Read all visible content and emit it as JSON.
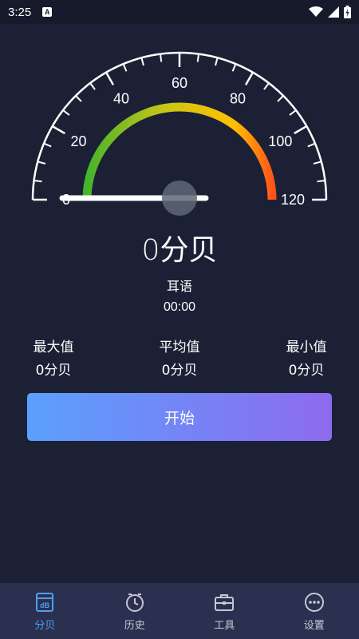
{
  "status_bar": {
    "time": "3:25",
    "badge": "A"
  },
  "gauge": {
    "min": 0,
    "max": 120,
    "tick_labels": [
      "0",
      "20",
      "40",
      "60",
      "80",
      "100",
      "120"
    ],
    "current_value": 0,
    "gradient_colors": [
      "#3db32c",
      "#c8c617",
      "#ffc000",
      "#ff4a1a"
    ],
    "needle_color": "#ffffff",
    "pivot_color": "#5f6977"
  },
  "reading": {
    "text": "0分贝"
  },
  "level_text": "耳语",
  "timer": "00:00",
  "stats": {
    "max": {
      "label": "最大值",
      "value": "0分贝"
    },
    "avg": {
      "label": "平均值",
      "value": "0分贝"
    },
    "min": {
      "label": "最小值",
      "value": "0分贝"
    }
  },
  "start_button": {
    "label": "开始"
  },
  "bottom_nav": {
    "items": [
      {
        "label": "分贝",
        "icon": "db-icon",
        "active": true
      },
      {
        "label": "历史",
        "icon": "history-clock-icon",
        "active": false
      },
      {
        "label": "工具",
        "icon": "toolbox-icon",
        "active": false
      },
      {
        "label": "设置",
        "icon": "more-dots-icon",
        "active": false
      }
    ]
  },
  "colors": {
    "background": "#1b2035",
    "nav_background": "#2b3050",
    "accent": "#4d9ff5"
  }
}
